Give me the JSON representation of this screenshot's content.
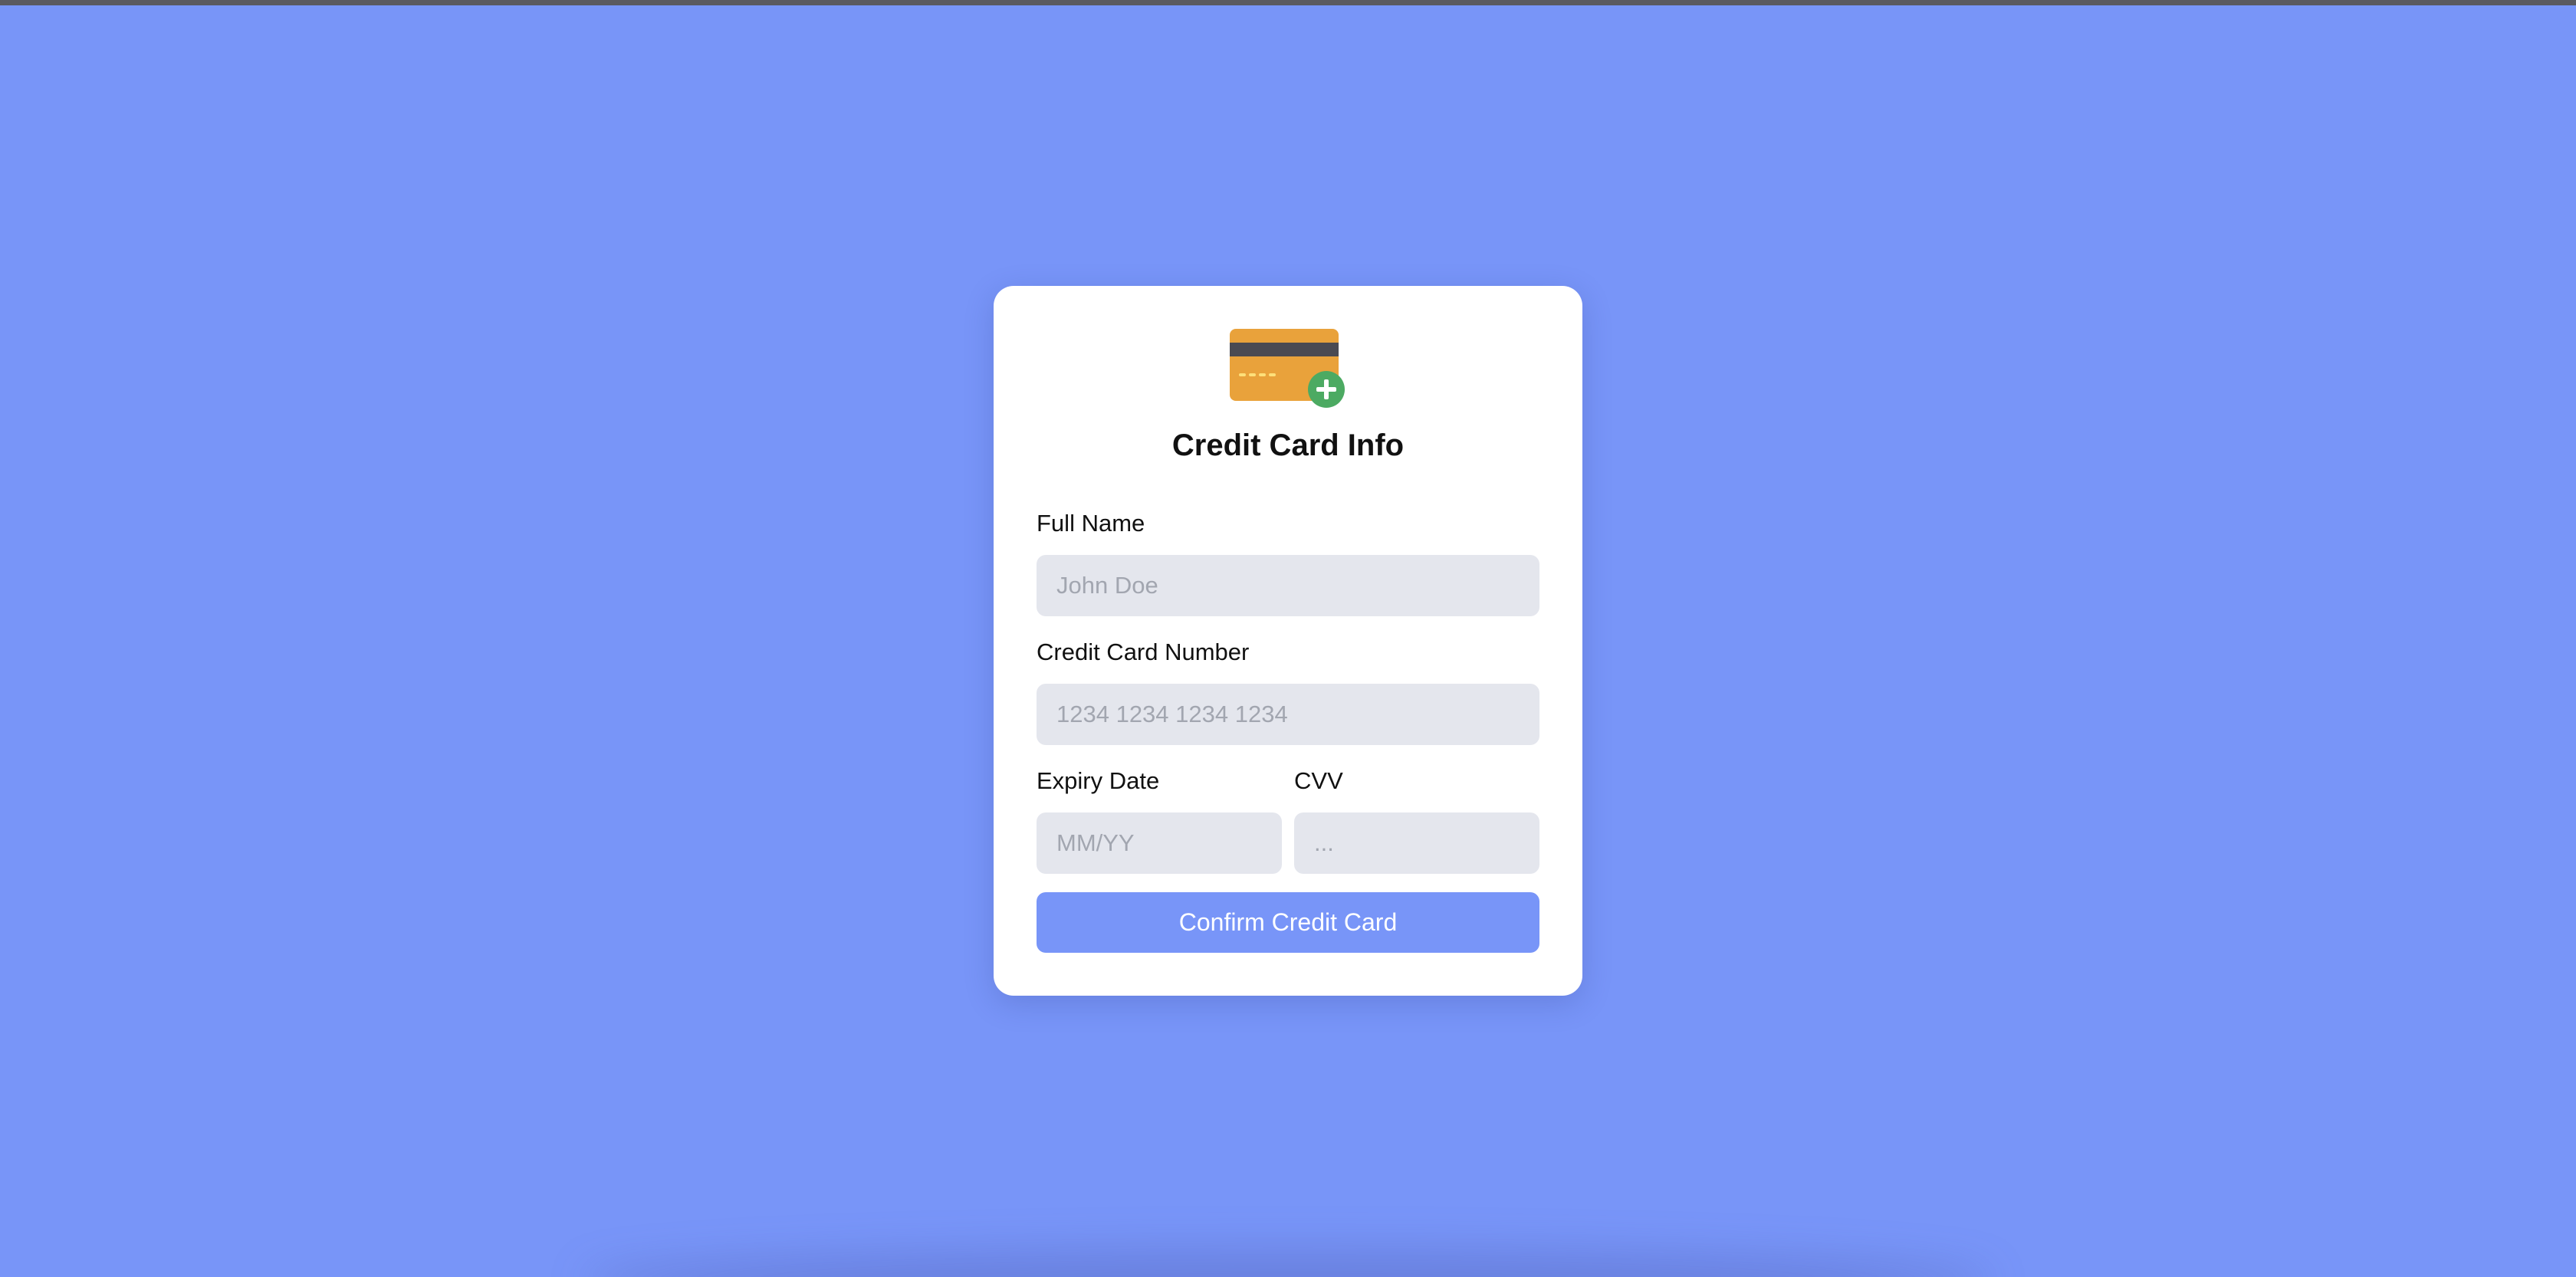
{
  "page": {
    "background_color": "#7895f8",
    "accent_color": "#7895f8"
  },
  "card": {
    "icon": "credit-card-add-icon",
    "title": "Credit Card Info"
  },
  "form": {
    "full_name": {
      "label": "Full Name",
      "placeholder": "John Doe",
      "value": ""
    },
    "card_number": {
      "label": "Credit Card Number",
      "placeholder": "1234 1234 1234 1234",
      "value": ""
    },
    "expiry": {
      "label": "Expiry Date",
      "placeholder": "MM/YY",
      "value": ""
    },
    "cvv": {
      "label": "CVV",
      "placeholder": "...",
      "value": ""
    },
    "confirm_label": "Confirm Credit Card"
  }
}
